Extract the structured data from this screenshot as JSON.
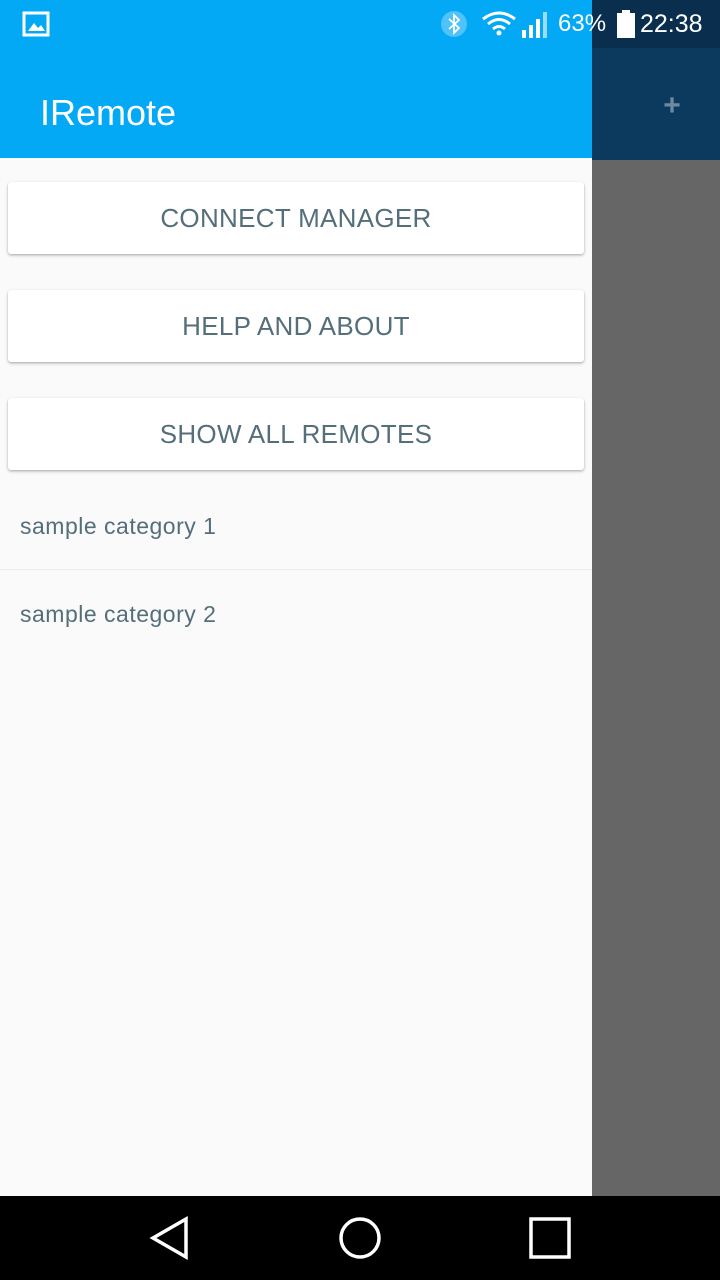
{
  "status_bar": {
    "battery_percent": "63%",
    "time": "22:38",
    "icons": [
      "image-notification-icon",
      "bluetooth-icon",
      "wifi-icon",
      "signal-icon",
      "battery-icon"
    ]
  },
  "background_app": {
    "action_icon": "+"
  },
  "drawer": {
    "title": "IRemote",
    "buttons": {
      "connect_manager": "CONNECT MANAGER",
      "help_about": "HELP AND ABOUT",
      "show_all_remotes": "SHOW ALL REMOTES"
    },
    "categories": [
      "sample category 1",
      "sample category 2"
    ]
  },
  "nav_bar": {
    "icons": [
      "back-icon",
      "home-icon",
      "recent-apps-icon"
    ]
  },
  "colors": {
    "primary": "#03a9f4",
    "text": "#546e7a",
    "scrim": "#666666"
  }
}
